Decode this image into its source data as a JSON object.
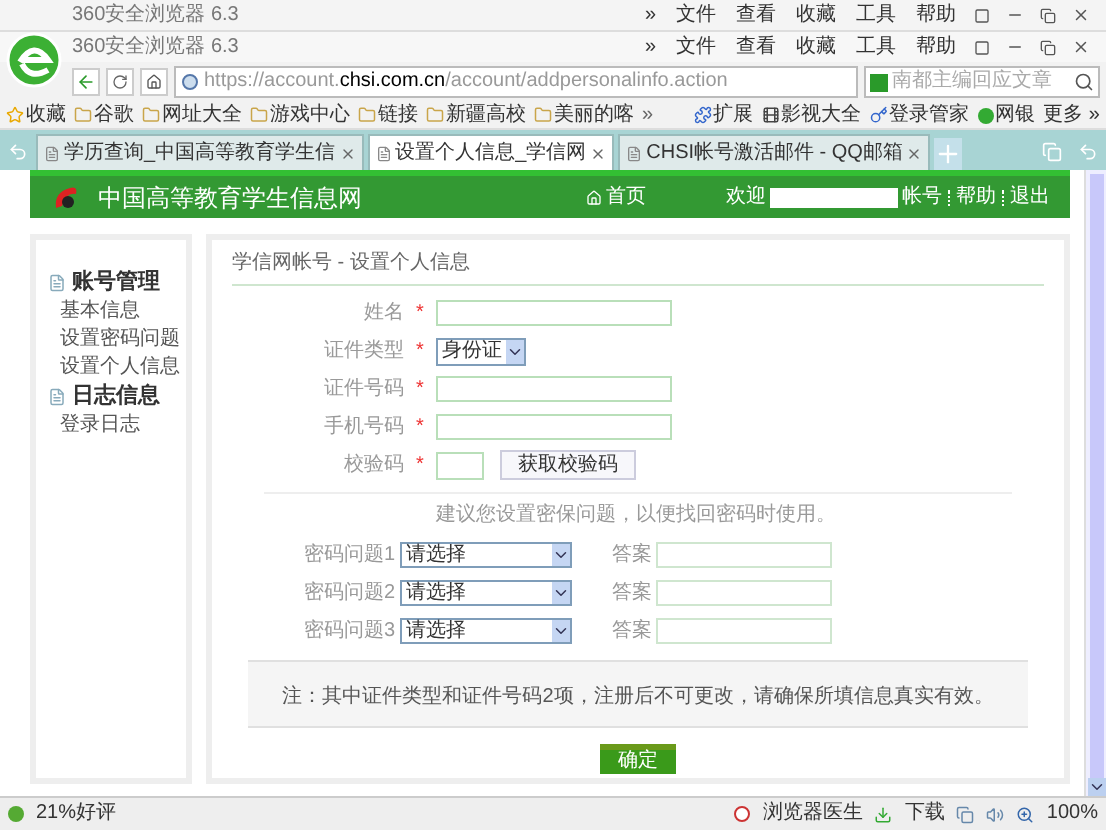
{
  "ghost_titlebar": {
    "title": "360安全浏览器 6.3",
    "menu": [
      "»",
      "文件",
      "查看",
      "收藏",
      "工具",
      "帮助"
    ]
  },
  "titlebar": {
    "title": "360安全浏览器 6.3",
    "menu": [
      "»",
      "文件",
      "查看",
      "收藏",
      "工具",
      "帮助"
    ]
  },
  "address_bar": {
    "url_parts": [
      {
        "text": "https://account.",
        "strong": false
      },
      {
        "text": "chsi.com.cn",
        "strong": true
      },
      {
        "text": "/account/addpersonalinfo.action",
        "strong": false
      }
    ],
    "search_placeholder": "南都主编回应文章"
  },
  "bookmarks": [
    "收藏",
    "谷歌",
    "网址大全",
    "游戏中心",
    "链接",
    "新疆高校",
    "美丽的喀"
  ],
  "bookmarks_more": "»",
  "extensions": [
    "扩展",
    "影视大全",
    "登录管家",
    "网银"
  ],
  "more": "更多 »",
  "tabs": [
    {
      "label": "学历查询_中国高等教育学生信",
      "selected": false
    },
    {
      "label": "设置个人信息_学信网",
      "selected": true
    },
    {
      "label": "CHSI帐号激活邮件 - QQ邮箱",
      "selected": false
    }
  ],
  "site": {
    "name": "中国高等教育学生信息网",
    "home": "首页",
    "welcome": "欢迎",
    "account": "帐号",
    "help": "帮助",
    "logout": "退出"
  },
  "sidebar": [
    {
      "title": "账号管理",
      "children": [
        {
          "label": "基本信息"
        },
        {
          "label": "设置密码问题"
        },
        {
          "label": "设置个人信息"
        }
      ]
    },
    {
      "title": "日志信息",
      "children": [
        {
          "label": "登录日志"
        }
      ]
    }
  ],
  "form": {
    "breadcrumb": "学信网帐号 - 设置个人信息",
    "fields": [
      {
        "kind": "text",
        "label": "姓名",
        "required_mark": "*"
      },
      {
        "kind": "select",
        "label": "证件类型",
        "required_mark": "*",
        "value": "身份证"
      },
      {
        "kind": "text",
        "label": "证件号码",
        "required_mark": "*"
      },
      {
        "kind": "text",
        "label": "手机号码",
        "required_mark": "*"
      },
      {
        "kind": "code",
        "label": "校验码",
        "required_mark": "*",
        "button": "获取校验码"
      }
    ],
    "hint": "建议您设置密保问题，以便找回密码时使用。",
    "questions": [
      {
        "label": "密码问题1",
        "value": "请选择",
        "answer_label": "答案"
      },
      {
        "label": "密码问题2",
        "value": "请选择",
        "answer_label": "答案"
      },
      {
        "label": "密码问题3",
        "value": "请选择",
        "answer_label": "答案"
      }
    ],
    "note": "注：其中证件类型和证件号码2项，注册后不可更改，请确保所填信息真实有效。",
    "submit": "确定"
  },
  "status_bar": {
    "rating": "21%好评",
    "doctor": "浏览器医生",
    "download": "下载",
    "zoom": "100%"
  }
}
